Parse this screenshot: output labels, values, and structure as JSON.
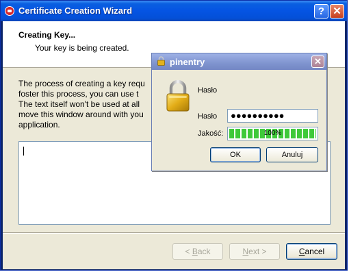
{
  "wizard": {
    "title": "Certificate Creation Wizard",
    "help_symbol": "?",
    "close_symbol": "✕",
    "header_title": "Creating Key...",
    "header_subtitle": "Your key is being created.",
    "body_lines": [
      "The process of creating a key requ",
      "foster this process, you can use t",
      "The text itself won't be used at all",
      "move this window around with you",
      "application."
    ],
    "entropy_text": "",
    "buttons": {
      "back_prefix": "< ",
      "back_accel": "B",
      "back_rest": "ack",
      "next_accel": "N",
      "next_rest": "ext >",
      "cancel_accel": "C",
      "cancel_rest": "ancel"
    },
    "colors": {
      "titlebar": "#0554e3",
      "face": "#ece9d8"
    }
  },
  "pinentry": {
    "title": "pinentry",
    "close_symbol": "✕",
    "icon": "padlock-icon",
    "description": "Hasło",
    "password_label": "Hasło",
    "password_value": "●●●●●●●●●●",
    "quality_label": "Jakość:",
    "quality_text": "100%",
    "quality_fraction": 1.0,
    "ok_label": "OK",
    "cancel_label": "Anuluj",
    "colors": {
      "quality_fill": "#3fc93a",
      "titlebar": "#8398d3"
    }
  }
}
